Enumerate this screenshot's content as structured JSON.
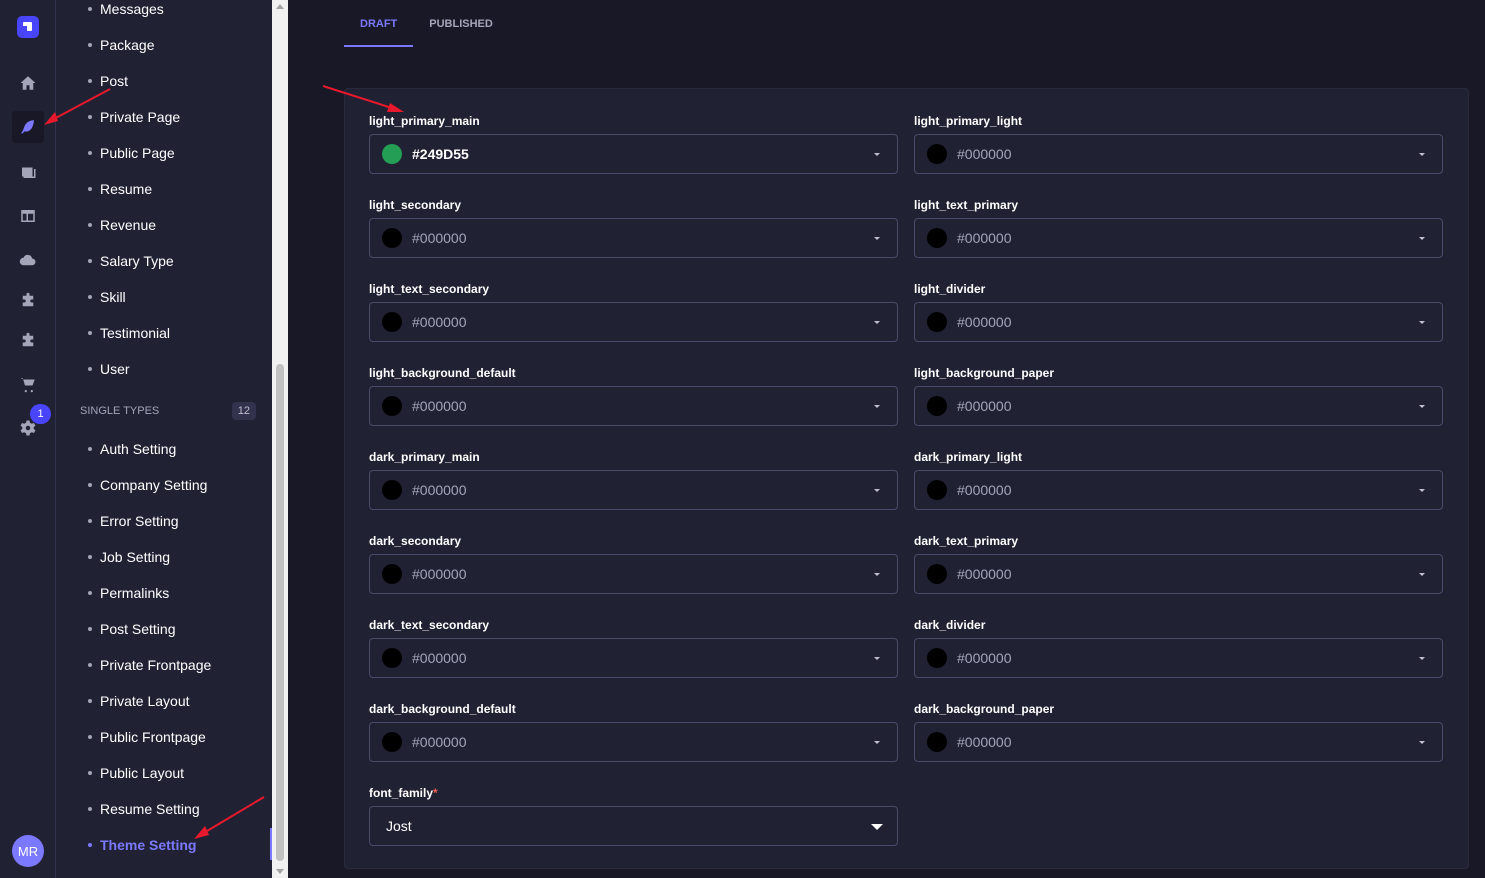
{
  "rail": {
    "items": [
      {
        "icon": "home-icon"
      },
      {
        "icon": "feather-icon",
        "active": true
      },
      {
        "icon": "media-library-icon"
      },
      {
        "icon": "layout-icon"
      },
      {
        "icon": "cloud-icon"
      },
      {
        "icon": "puzzle-icon"
      },
      {
        "icon": "puzzle-icon"
      },
      {
        "icon": "cart-icon"
      },
      {
        "icon": "gear-icon"
      }
    ],
    "settings_badge": "1",
    "avatar_initials": "MR"
  },
  "subnav": {
    "collection_items": [
      "Messages",
      "Package",
      "Post",
      "Private Page",
      "Public Page",
      "Resume",
      "Revenue",
      "Salary Type",
      "Skill",
      "Testimonial",
      "User"
    ],
    "single_types_title": "SINGLE TYPES",
    "single_types_count": "12",
    "single_items": [
      "Auth Setting",
      "Company Setting",
      "Error Setting",
      "Job Setting",
      "Permalinks",
      "Post Setting",
      "Private Frontpage",
      "Private Layout",
      "Public Frontpage",
      "Public Layout",
      "Resume Setting",
      "Theme Setting"
    ],
    "active_item": "Theme Setting"
  },
  "tabs": [
    {
      "label": "DRAFT",
      "active": true
    },
    {
      "label": "PUBLISHED",
      "active": false
    }
  ],
  "form": {
    "fields": [
      {
        "label": "light_primary_main",
        "value": "#249D55",
        "swatch": "#249D55"
      },
      {
        "label": "light_primary_light",
        "value": "#000000",
        "swatch": "#000000"
      },
      {
        "label": "light_secondary",
        "value": "#000000",
        "swatch": "#000000"
      },
      {
        "label": "light_text_primary",
        "value": "#000000",
        "swatch": "#000000"
      },
      {
        "label": "light_text_secondary",
        "value": "#000000",
        "swatch": "#000000"
      },
      {
        "label": "light_divider",
        "value": "#000000",
        "swatch": "#000000"
      },
      {
        "label": "light_background_default",
        "value": "#000000",
        "swatch": "#000000"
      },
      {
        "label": "light_background_paper",
        "value": "#000000",
        "swatch": "#000000"
      },
      {
        "label": "dark_primary_main",
        "value": "#000000",
        "swatch": "#000000"
      },
      {
        "label": "dark_primary_light",
        "value": "#000000",
        "swatch": "#000000"
      },
      {
        "label": "dark_secondary",
        "value": "#000000",
        "swatch": "#000000"
      },
      {
        "label": "dark_text_primary",
        "value": "#000000",
        "swatch": "#000000"
      },
      {
        "label": "dark_text_secondary",
        "value": "#000000",
        "swatch": "#000000"
      },
      {
        "label": "dark_divider",
        "value": "#000000",
        "swatch": "#000000"
      },
      {
        "label": "dark_background_default",
        "value": "#000000",
        "swatch": "#000000"
      },
      {
        "label": "dark_background_paper",
        "value": "#000000",
        "swatch": "#000000"
      }
    ],
    "font_family": {
      "label": "font_family",
      "required_mark": "*",
      "value": "Jost"
    }
  },
  "colors": {
    "accent": "#7b79ff",
    "annotation_arrow": "#e8192c"
  }
}
